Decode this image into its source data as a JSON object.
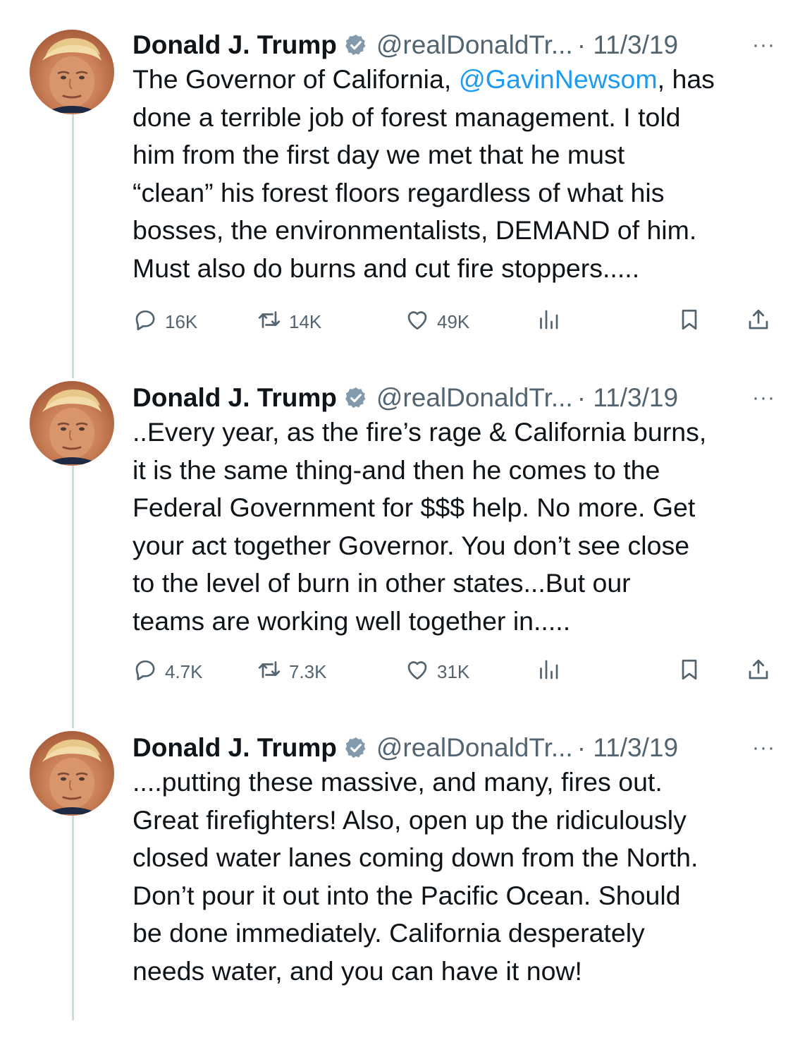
{
  "tweets": [
    {
      "display_name": "Donald J. Trump",
      "handle": "@realDonaldTr...",
      "date": "· 11/3/19",
      "more": "···",
      "lines": [
        {
          "pre": "The Governor of California, ",
          "mention": "@GavinNewsom",
          "post": ", has"
        },
        {
          "text": "done a terrible job of forest management. I told"
        },
        {
          "text": "him from the first day we met that he must"
        },
        {
          "text": "“clean” his forest floors regardless of what his"
        },
        {
          "text": "bosses, the environmentalists, DEMAND of him."
        },
        {
          "text": "Must also do burns and cut fire stoppers....."
        }
      ],
      "replies": "16K",
      "retweets": "14K",
      "likes": "49K"
    },
    {
      "display_name": "Donald J. Trump",
      "handle": "@realDonaldTr...",
      "date": "· 11/3/19",
      "more": "···",
      "lines": [
        {
          "text": "..Every year, as the fire’s rage & California burns,"
        },
        {
          "text": "it is the same thing-and then he comes to the"
        },
        {
          "text": "Federal Government for $$$ help. No more. Get"
        },
        {
          "text": "your act together Governor. You don’t see close"
        },
        {
          "text": "to the level of burn in other states...But our"
        },
        {
          "text": "teams are working well together in....."
        }
      ],
      "replies": "4.7K",
      "retweets": "7.3K",
      "likes": "31K"
    },
    {
      "display_name": "Donald J. Trump",
      "handle": "@realDonaldTr...",
      "date": "· 11/3/19",
      "more": "···",
      "lines": [
        {
          "text": "....putting these massive, and many, fires out."
        },
        {
          "text": "Great firefighters! Also, open up the ridiculously"
        },
        {
          "text": "closed water lanes coming down from the North."
        },
        {
          "text": "Don’t pour it out into the Pacific Ocean. Should"
        },
        {
          "text": "be done immediately. California desperately"
        },
        {
          "text": "needs water, and you can have it now!"
        }
      ]
    }
  ],
  "icons": {
    "reply": "reply-icon",
    "retweet": "retweet-icon",
    "like": "heart-icon",
    "views": "views-icon",
    "bookmark": "bookmark-icon",
    "share": "share-icon",
    "verified": "verified-badge-icon"
  },
  "colors": {
    "text": "#0f1419",
    "secondary": "#536471",
    "mention": "#1d9bf0",
    "thread_line": "#cfd9de",
    "verified_badge": "#829aab"
  }
}
